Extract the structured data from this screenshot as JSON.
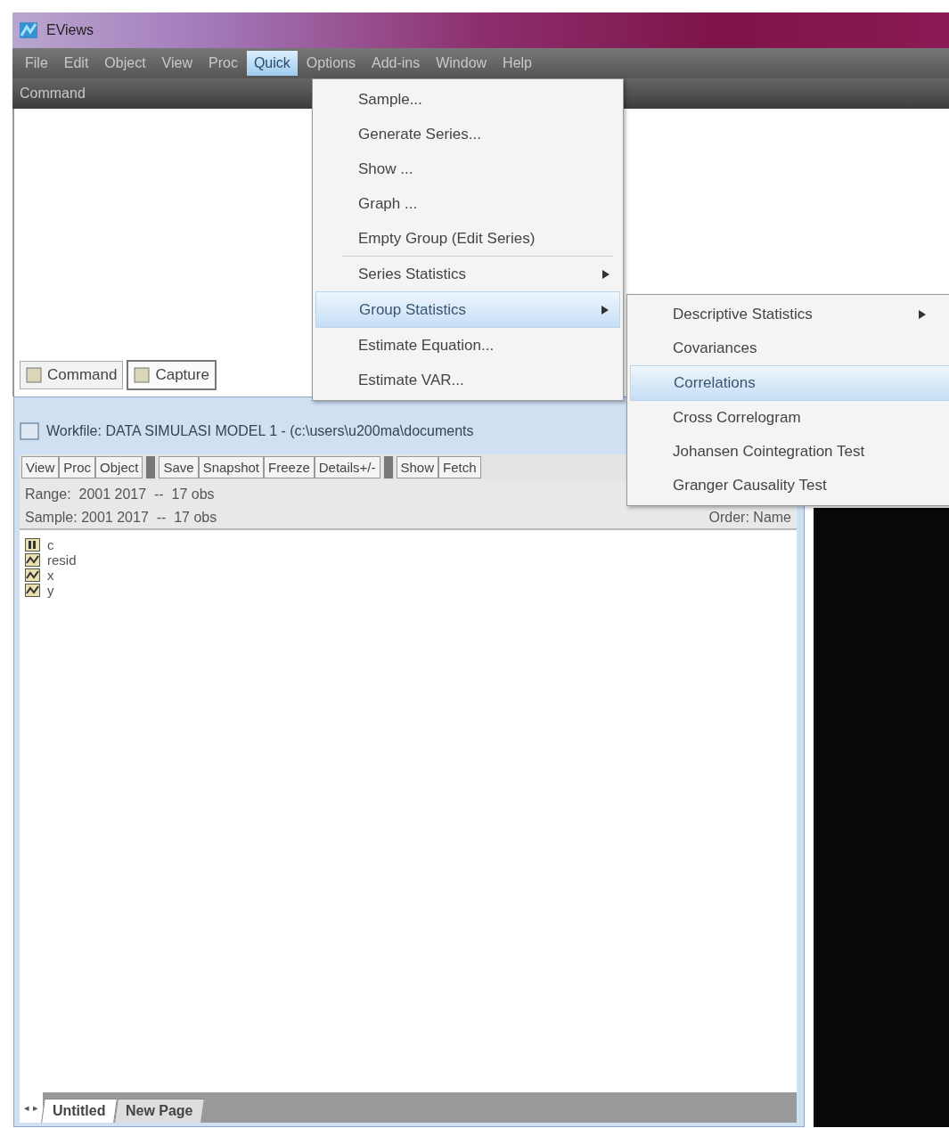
{
  "window": {
    "title": "EViews"
  },
  "menubar": [
    {
      "label": "File",
      "selected": false
    },
    {
      "label": "Edit",
      "selected": false
    },
    {
      "label": "Object",
      "selected": false
    },
    {
      "label": "View",
      "selected": false
    },
    {
      "label": "Proc",
      "selected": false
    },
    {
      "label": "Quick",
      "selected": true
    },
    {
      "label": "Options",
      "selected": false
    },
    {
      "label": "Add-ins",
      "selected": false
    },
    {
      "label": "Window",
      "selected": false
    },
    {
      "label": "Help",
      "selected": false
    }
  ],
  "command_window": {
    "title": "Command",
    "tabs": [
      {
        "label": "Command",
        "selected": false
      },
      {
        "label": "Capture",
        "selected": true
      }
    ]
  },
  "quick_menu": {
    "items": [
      {
        "label": "Sample...",
        "submenu": false,
        "selected": false
      },
      {
        "label": "Generate Series...",
        "submenu": false,
        "selected": false
      },
      {
        "label": "Show ...",
        "submenu": false,
        "selected": false
      },
      {
        "label": "Graph ...",
        "submenu": false,
        "selected": false
      },
      {
        "label": "Empty Group (Edit Series)",
        "submenu": false,
        "selected": false,
        "separator_after": true
      },
      {
        "label": "Series Statistics",
        "submenu": true,
        "selected": false
      },
      {
        "label": "Group Statistics",
        "submenu": true,
        "selected": true
      },
      {
        "label": "Estimate Equation...",
        "submenu": false,
        "selected": false
      },
      {
        "label": "Estimate VAR...",
        "submenu": false,
        "selected": false
      }
    ]
  },
  "group_statistics_submenu": {
    "items": [
      {
        "label": "Descriptive Statistics",
        "submenu": true,
        "selected": false
      },
      {
        "label": "Covariances",
        "submenu": false,
        "selected": false
      },
      {
        "label": "Correlations",
        "submenu": false,
        "selected": true
      },
      {
        "label": "Cross Correlogram",
        "submenu": false,
        "selected": false
      },
      {
        "label": "Johansen Cointegration Test",
        "submenu": false,
        "selected": false
      },
      {
        "label": "Granger Causality Test",
        "submenu": false,
        "selected": false
      }
    ]
  },
  "workfile": {
    "title": "Workfile: DATA SIMULASI MODEL 1 - (c:\\users\\u200ma\\documents",
    "toolbar": [
      [
        "View",
        "Proc",
        "Object"
      ],
      [
        "Save",
        "Snapshot",
        "Freeze",
        "Details+/-"
      ],
      [
        "Show",
        "Fetch"
      ]
    ],
    "range": "Range:  2001 2017  --  17 obs",
    "sample": "Sample: 2001 2017  --  17 obs",
    "order": "Order: Name",
    "objects": [
      {
        "name": "c",
        "kind": "coef"
      },
      {
        "name": "resid",
        "kind": "series"
      },
      {
        "name": "x",
        "kind": "series"
      },
      {
        "name": "y",
        "kind": "series"
      }
    ],
    "nav": [
      "◂",
      "▸"
    ],
    "pages": [
      {
        "label": "Untitled",
        "selected": true
      },
      {
        "label": "New Page",
        "selected": false
      }
    ]
  }
}
